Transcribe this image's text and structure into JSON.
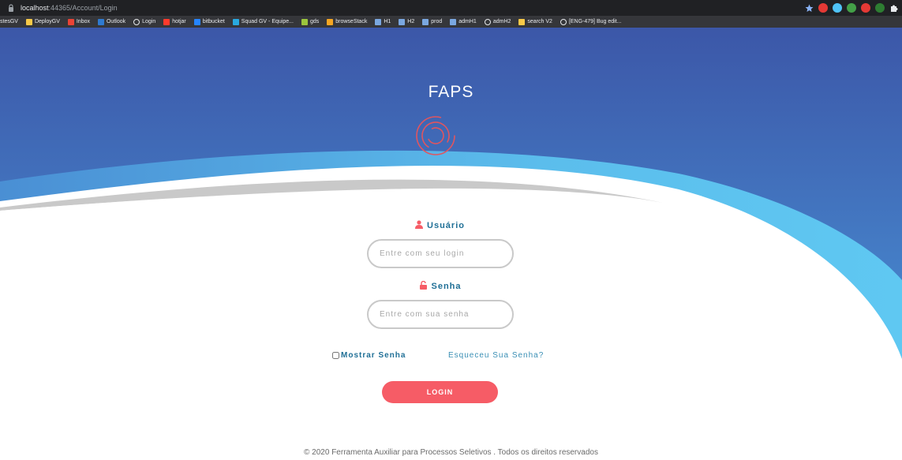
{
  "browser": {
    "url_host": "localhost",
    "url_rest": ":44365/Account/Login",
    "bookmarks": [
      {
        "label": "stesGV",
        "icon": "none",
        "color": ""
      },
      {
        "label": "DeployGV",
        "icon": "folder-icon",
        "color": "#f7c948"
      },
      {
        "label": "Inbox",
        "icon": "gmail-icon",
        "color": "#ea4335"
      },
      {
        "label": "Outlook",
        "icon": "outlook-icon",
        "color": "#2f7ad0"
      },
      {
        "label": "Login",
        "icon": "globe-icon",
        "color": "#e8eaed"
      },
      {
        "label": "hotjar",
        "icon": "hotjar-icon",
        "color": "#fd3a2d"
      },
      {
        "label": "bitbucket",
        "icon": "bitbucket-icon",
        "color": "#2684ff"
      },
      {
        "label": "Squad GV - Equipe...",
        "icon": "diamond-icon",
        "color": "#29a8e0"
      },
      {
        "label": "gds",
        "icon": "leaf-icon",
        "color": "#9bc53d"
      },
      {
        "label": "browseStack",
        "icon": "browserstack-icon",
        "color": "#f5a623"
      },
      {
        "label": "H1",
        "icon": "monitor-icon",
        "color": "#7aa7e0"
      },
      {
        "label": "H2",
        "icon": "monitor-icon",
        "color": "#7aa7e0"
      },
      {
        "label": "prod",
        "icon": "monitor-icon",
        "color": "#7aa7e0"
      },
      {
        "label": "admH1",
        "icon": "monitor-icon",
        "color": "#7aa7e0"
      },
      {
        "label": "admH2",
        "icon": "globe-icon",
        "color": "#e8eaed"
      },
      {
        "label": "search V2",
        "icon": "folder-icon",
        "color": "#f7c948"
      },
      {
        "label": "[ENG-479] Bug edit...",
        "icon": "globe-icon",
        "color": "#e8eaed"
      }
    ],
    "extensions": [
      {
        "icon": "star-icon",
        "color": "#8ab4f8"
      },
      {
        "icon": "stop-extension-icon",
        "color": "#e53935"
      },
      {
        "icon": "circle-extension-icon",
        "color": "#4fc3f7"
      },
      {
        "icon": "check-extension-icon",
        "color": "#43a047"
      },
      {
        "icon": "red-extension-icon",
        "color": "#e53935"
      },
      {
        "icon": "green-extension-icon",
        "color": "#2e7d32"
      },
      {
        "icon": "puzzle-icon",
        "color": "#e8eaed"
      }
    ]
  },
  "brand": {
    "name": "FAPS",
    "logo_color": "#e0555f"
  },
  "colors": {
    "hero_top": "#3a5dab",
    "wave_light": "#5bc4f0",
    "accent_red": "#f65c66",
    "label_blue": "#1f6f96"
  },
  "form": {
    "user_label": "Usuário",
    "user_placeholder": "Entre com seu login",
    "password_label": "Senha",
    "password_placeholder": "Entre com sua senha",
    "show_password_label": "Mostrar Senha",
    "forgot_password": "Esqueceu Sua Senha?",
    "login_button": "LOGIN"
  },
  "footer": {
    "text": "© 2020 Ferramenta Auxiliar para Processos Seletivos . Todos os direitos reservados"
  }
}
